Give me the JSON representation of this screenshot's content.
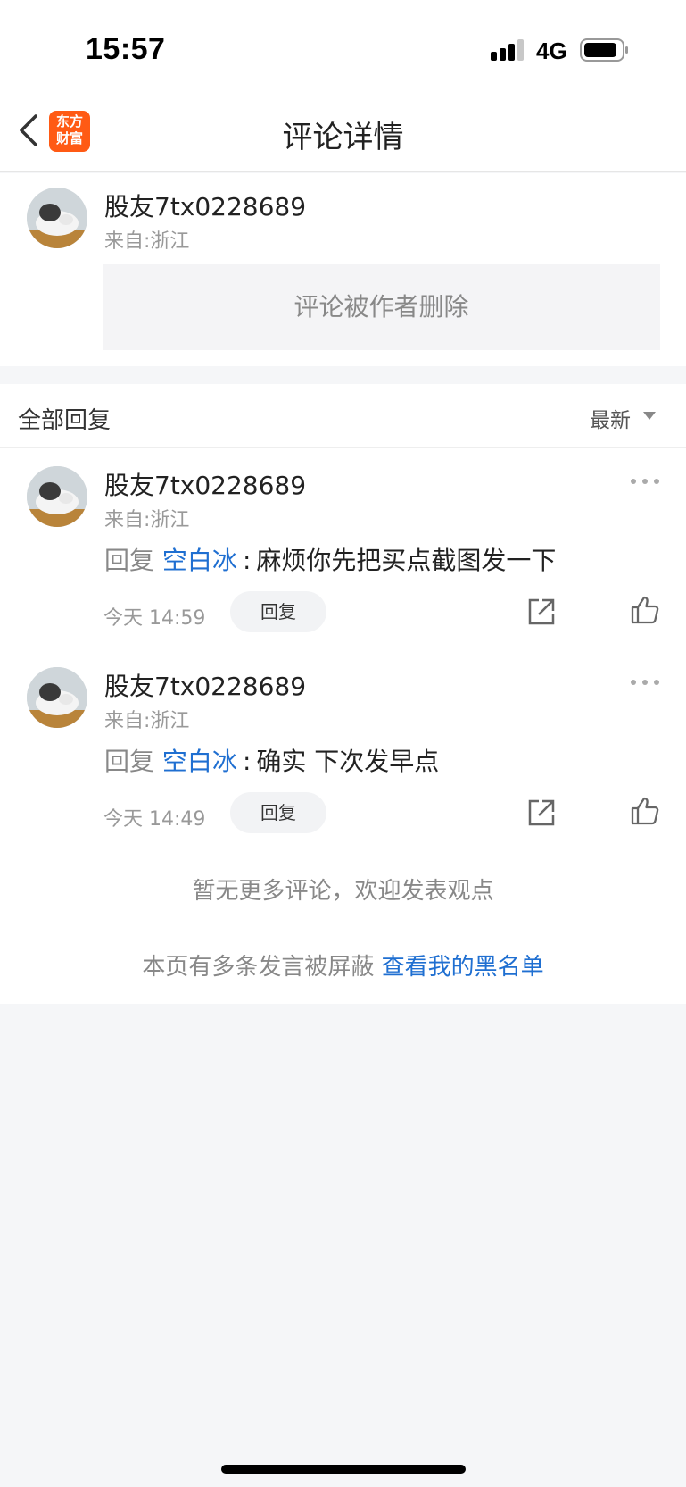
{
  "status_bar": {
    "time": "15:57",
    "network": "4G"
  },
  "nav": {
    "title": "评论详情",
    "logo_line1": "东方",
    "logo_line2": "财富"
  },
  "main_comment": {
    "username": "股友7tx0228689",
    "location": "来自:浙江",
    "deleted_text": "评论被作者删除"
  },
  "replies_header": {
    "title": "全部回复",
    "sort": "最新"
  },
  "replies": [
    {
      "username": "股友7tx0228689",
      "location": "来自:浙江",
      "prefix": "回复",
      "mention": "空白冰",
      "colon": ":",
      "text": "麻烦你先把买点截图发一下",
      "time": "今天 14:59",
      "reply_label": "回复"
    },
    {
      "username": "股友7tx0228689",
      "location": "来自:浙江",
      "prefix": "回复",
      "mention": "空白冰",
      "colon": ":",
      "text": "确实 下次发早点",
      "time": "今天 14:49",
      "reply_label": "回复"
    }
  ],
  "footer": {
    "no_more": "暂无更多评论，欢迎发表观点",
    "blocked_note": "本页有多条发言被屏蔽",
    "blacklist_link": "查看我的黑名单"
  },
  "icons": [
    "back-icon",
    "signal-icon",
    "battery-icon",
    "more-icon",
    "share-icon",
    "like-icon",
    "chevron-down-icon"
  ],
  "colors": {
    "link": "#1f6fd1",
    "logo": "#ff5a14",
    "background": "#f5f6f8"
  }
}
